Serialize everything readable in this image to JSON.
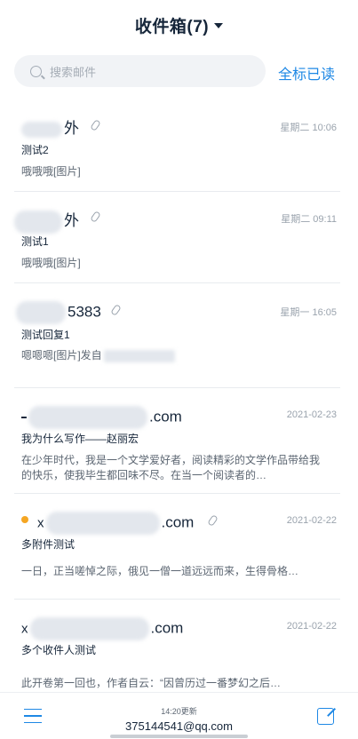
{
  "header": {
    "title": "收件箱(7)"
  },
  "search": {
    "placeholder": "搜索邮件",
    "mark_all_read": "全标已读"
  },
  "mails": [
    {
      "sender_visible": "外",
      "date": "星期二 10:06",
      "subject": "测试2",
      "preview": "哦哦哦[图片]",
      "attachment": true,
      "unread": false
    },
    {
      "sender_visible": "外",
      "date": "星期二 09:11",
      "subject": "测试1",
      "preview": "哦哦哦[图片]",
      "attachment": true,
      "unread": false
    },
    {
      "sender_visible": "5383",
      "date": "星期一 16:05",
      "subject": "测试回复1",
      "preview": "嗯嗯嗯[图片]发自",
      "attachment": true,
      "unread": false
    },
    {
      "sender_visible": ".com",
      "date": "2021-02-23",
      "subject": "我为什么写作——赵丽宏",
      "preview": "  在少年时代，我是一个文学爱好者，阅读精彩的文学作品带给我的快乐，使我毕生都回味不尽。在当一个阅读者的…",
      "attachment": false,
      "unread": false
    },
    {
      "sender_visible": ".com",
      "date": "2021-02-22",
      "subject": "多附件测试",
      "preview": "一日，正当嗟悼之际，俄见一僧一道远远而来，生得骨格…",
      "attachment": true,
      "unread": true
    },
    {
      "sender_visible": ".com",
      "date": "2021-02-22",
      "subject": "多个收件人测试",
      "preview": "此开卷第一回也，作者自云：“因曾历过一番梦幻之后…",
      "attachment": false,
      "unread": false
    }
  ],
  "footer": {
    "update_time": "14:20更新",
    "account": "375144541@qq.com"
  },
  "colors": {
    "accent": "#1e88e5",
    "unread": "#f5a623",
    "text": "#16263a"
  }
}
